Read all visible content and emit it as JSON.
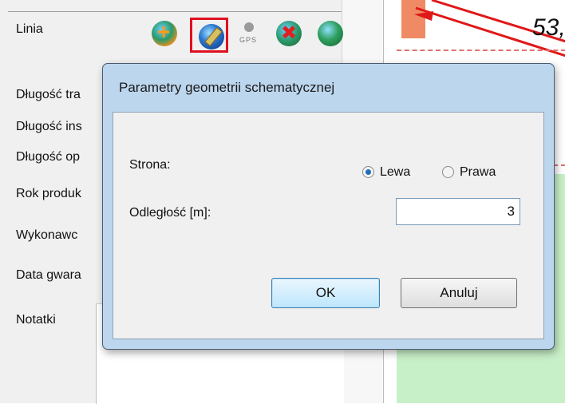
{
  "form": {
    "title_label": "Linia",
    "labels": [
      "Długość tra",
      "Długość ins",
      "Długość op",
      "Rok produk",
      "Wykonawc",
      "Data gwara",
      "Notatki"
    ]
  },
  "toolbar": {
    "icons": [
      "add-globe-icon",
      "edit-schematic-globe-icon",
      "gps-icon",
      "delete-globe-icon",
      "globe-icon"
    ],
    "gps_text": "GPS",
    "highlight_color": "#e01020"
  },
  "map": {
    "label": "53,"
  },
  "dialog": {
    "title": "Parametry geometrii schematycznej",
    "side_label": "Strona:",
    "side_left": "Lewa",
    "side_right": "Prawa",
    "side_selected": "Lewa",
    "distance_label": "Odległość [m]:",
    "distance_value": "3",
    "ok_label": "OK",
    "cancel_label": "Anuluj"
  }
}
